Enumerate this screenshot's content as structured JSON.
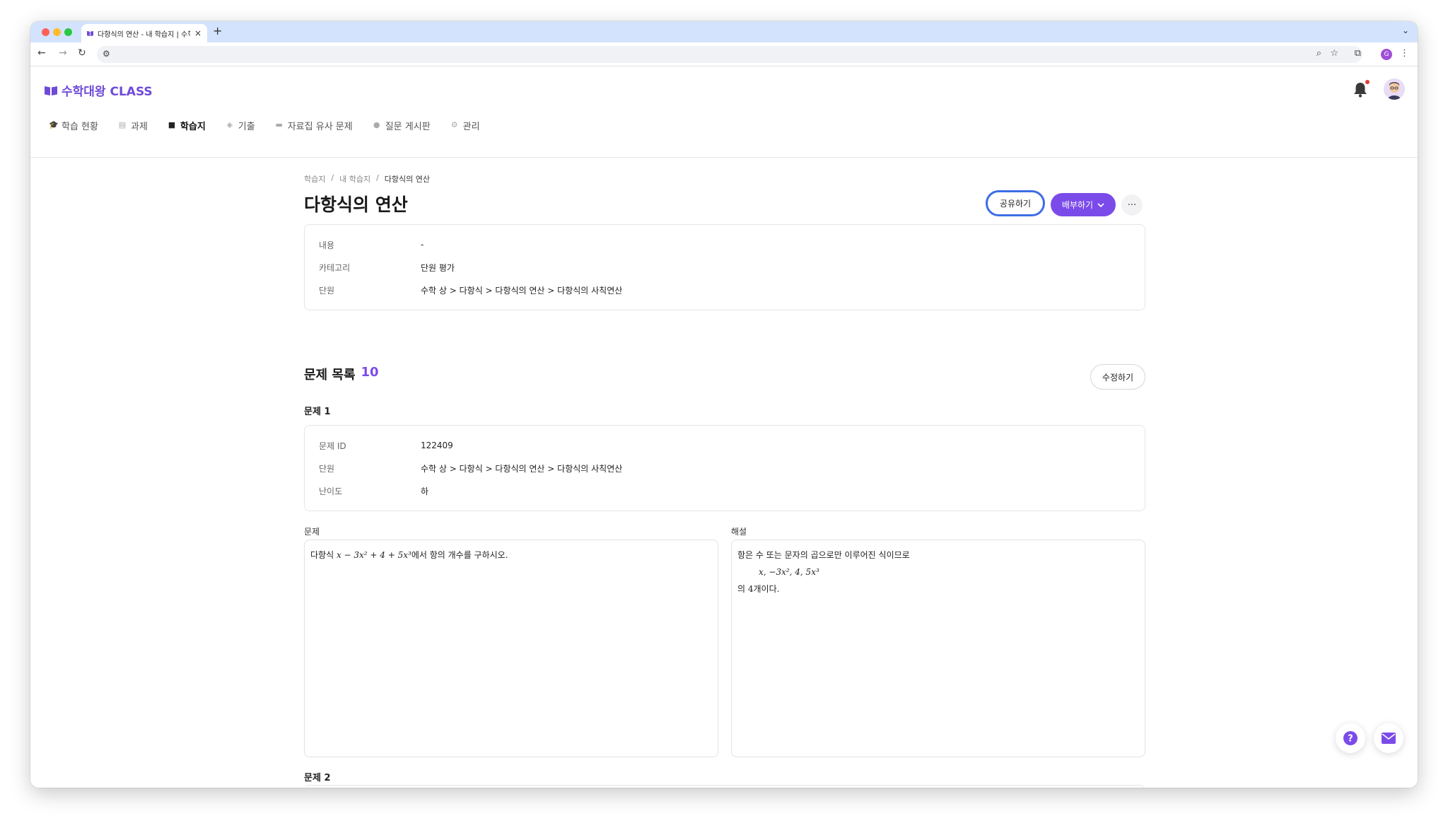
{
  "browser": {
    "tab_title": "다항식의 연산 - 내 학습지 | 수학대",
    "tab_close": "×",
    "new_tab": "+",
    "profile_initial": "G"
  },
  "app": {
    "logo_text": "수학대왕 CLASS",
    "brand_color": "#6f4bd8",
    "nav": [
      {
        "label": "학습 현황",
        "icon": "graduation-cap-icon"
      },
      {
        "label": "과제",
        "icon": "document-icon"
      },
      {
        "label": "학습지",
        "icon": "sticky-note-icon",
        "active": true
      },
      {
        "label": "기출",
        "icon": "layers-icon"
      },
      {
        "label": "자료집 유사 문제",
        "icon": "folder-icon"
      },
      {
        "label": "질문 게시판",
        "icon": "chat-bubble-icon"
      },
      {
        "label": "관리",
        "icon": "gear-icon"
      }
    ]
  },
  "breadcrumb": [
    "학습지",
    "내 학습지",
    "다항식의 연산"
  ],
  "breadcrumb_sep": "/",
  "page": {
    "title": "다항식의 연산",
    "share_label": "공유하기",
    "distribute_label": "배부하기",
    "more_label": "···"
  },
  "info": [
    {
      "label": "내용",
      "value": "-"
    },
    {
      "label": "카테고리",
      "value": "단원 평가"
    },
    {
      "label": "단원",
      "value": "수학 상 > 다항식 > 다항식의 연산 > 다항식의 사칙연산"
    }
  ],
  "problem_list": {
    "title": "문제 목록",
    "count": "10",
    "edit_label": "수정하기"
  },
  "problems": [
    {
      "heading": "문제 1",
      "meta": [
        {
          "label": "문제 ID",
          "value": "122409"
        },
        {
          "label": "단원",
          "value": "수학 상 > 다항식 > 다항식의 연산 > 다항식의 사칙연산"
        },
        {
          "label": "난이도",
          "value": "하"
        }
      ],
      "question_label": "문제",
      "question_prefix": "다항식 ",
      "question_math": "x − 3x² + 4 + 5x³",
      "question_suffix": "에서 항의 개수를 구하시오.",
      "solution_label": "해설",
      "solution_line1": "항은 수 또는 문자의 곱으로만 이루어진 식이므로",
      "solution_math": "x,  −3x²,  4,  5x³",
      "solution_line3": "의 4개이다."
    },
    {
      "heading": "문제 2"
    }
  ]
}
